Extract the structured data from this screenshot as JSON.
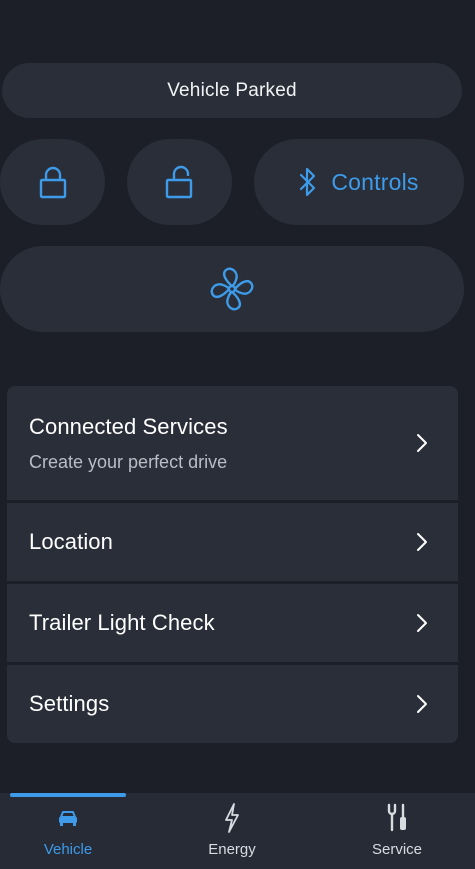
{
  "status": {
    "text": "Vehicle Parked"
  },
  "quick_controls": {
    "lock_icon": "lock-icon",
    "unlock_icon": "unlock-icon",
    "controls_icon": "bluetooth-icon",
    "controls_label": "Controls",
    "climate_icon": "fan-icon"
  },
  "menu": {
    "items": [
      {
        "title": "Connected Services",
        "subtitle": "Create your perfect drive",
        "icon": "chevron-right-icon"
      },
      {
        "title": "Location",
        "icon": "chevron-right-icon"
      },
      {
        "title": "Trailer Light Check",
        "icon": "chevron-right-icon"
      },
      {
        "title": "Settings",
        "icon": "chevron-right-icon"
      }
    ]
  },
  "bottom_nav": {
    "items": [
      {
        "label": "Vehicle",
        "icon": "car-icon",
        "active": true
      },
      {
        "label": "Energy",
        "icon": "lightning-icon",
        "active": false
      },
      {
        "label": "Service",
        "icon": "tools-icon",
        "active": false
      }
    ]
  },
  "colors": {
    "background": "#1c1f28",
    "surface": "#2a2e39",
    "accent": "#3d9be9",
    "text_primary": "#ffffff",
    "text_secondary": "#b9bdc6"
  }
}
